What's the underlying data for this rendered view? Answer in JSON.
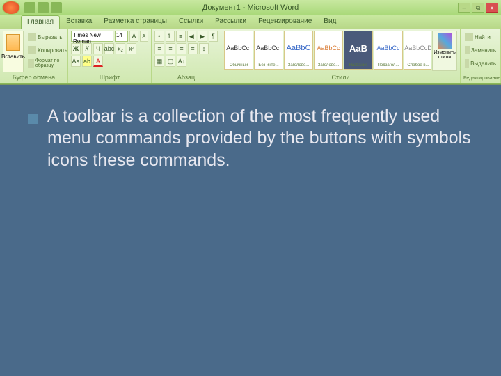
{
  "titlebar": {
    "title": "Документ1 - Microsoft Word",
    "minimize": "–",
    "restore": "⧉",
    "close": "x"
  },
  "tabs": [
    "Главная",
    "Вставка",
    "Разметка страницы",
    "Ссылки",
    "Рассылки",
    "Рецензирование",
    "Вид"
  ],
  "clipboard": {
    "label": "Буфер обмена",
    "paste": "Вставить",
    "cut": "Вырезать",
    "copy": "Копировать",
    "format": "Формат по образцу"
  },
  "font": {
    "label": "Шрифт",
    "family": "Times New Roman",
    "size": "14",
    "bold": "Ж",
    "italic": "К",
    "underline": "Ч"
  },
  "paragraph": {
    "label": "Абзац"
  },
  "styles": {
    "label": "Стили",
    "change": "Изменить стили",
    "items": [
      {
        "preview": "AaBbCcI",
        "name": "Обычный"
      },
      {
        "preview": "AaBbCcI",
        "name": "Без инте..."
      },
      {
        "preview": "AaBbC",
        "name": "Заголово..."
      },
      {
        "preview": "AaBbCc",
        "name": "Заголово..."
      },
      {
        "preview": "AaB",
        "name": "Название"
      },
      {
        "preview": "AaBbCc",
        "name": "Подзагол..."
      },
      {
        "preview": "AaBbCcD",
        "name": "Слабое в..."
      }
    ]
  },
  "editing": {
    "label": "Редактирование",
    "find": "Найти",
    "replace": "Заменить",
    "select": "Выделить"
  },
  "slide": {
    "text": "A toolbar is a collection of the most frequently used menu commands provided by the buttons with symbols icons these commands."
  }
}
